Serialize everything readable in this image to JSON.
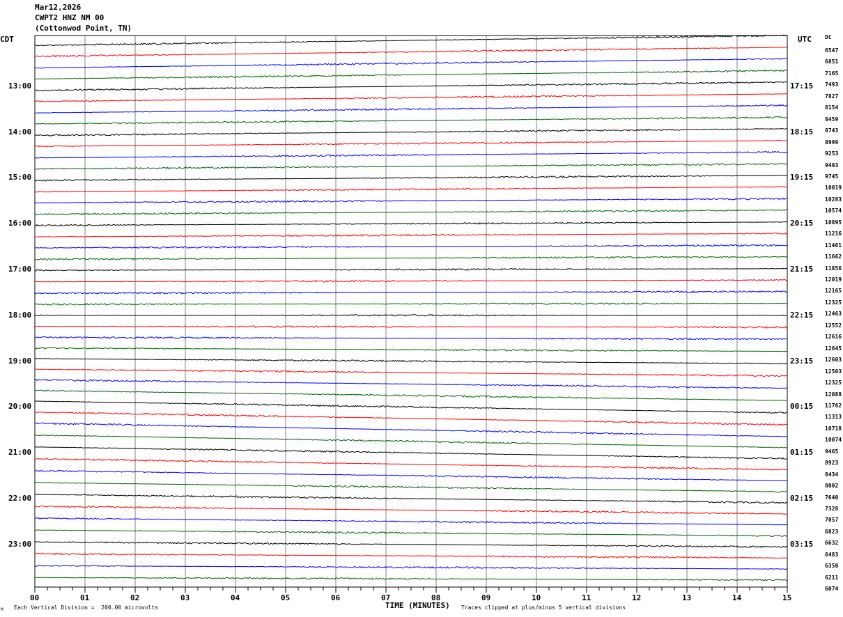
{
  "header": {
    "date": "Mar12,2026",
    "station": "CWPT2 HNZ NM 00",
    "location": "(Cottonwod Point, TN)"
  },
  "left_timezone": "CDT",
  "right_timezone": "UTC",
  "dc_label": "DC",
  "footer": {
    "scale_note": "Each Vertical Division =  200.00 microvolts",
    "clip_note": "Traces clipped at plus/minus 5 vertical divisions",
    "corner_mark": "M"
  },
  "colors": [
    "#000000",
    "#ff0000",
    "#0000ff",
    "#006400"
  ],
  "chart_data": {
    "type": "line",
    "xlabel": "TIME (MINUTES)",
    "x_ticks": [
      "00",
      "01",
      "02",
      "03",
      "04",
      "05",
      "06",
      "07",
      "08",
      "09",
      "10",
      "11",
      "12",
      "13",
      "14",
      "15"
    ],
    "xlim": [
      0,
      15
    ],
    "left_hour_labels": [
      {
        "trace": 4,
        "label": "13:00"
      },
      {
        "trace": 8,
        "label": "14:00"
      },
      {
        "trace": 12,
        "label": "15:00"
      },
      {
        "trace": 16,
        "label": "16:00"
      },
      {
        "trace": 20,
        "label": "17:00"
      },
      {
        "trace": 24,
        "label": "18:00"
      },
      {
        "trace": 28,
        "label": "19:00"
      },
      {
        "trace": 32,
        "label": "20:00"
      },
      {
        "trace": 36,
        "label": "21:00"
      },
      {
        "trace": 40,
        "label": "22:00"
      },
      {
        "trace": 44,
        "label": "23:00"
      }
    ],
    "right_hour_labels": [
      {
        "trace": 4,
        "label": "17:15"
      },
      {
        "trace": 8,
        "label": "18:15"
      },
      {
        "trace": 12,
        "label": "19:15"
      },
      {
        "trace": 16,
        "label": "20:15"
      },
      {
        "trace": 20,
        "label": "21:15"
      },
      {
        "trace": 24,
        "label": "22:15"
      },
      {
        "trace": 28,
        "label": "23:15"
      },
      {
        "trace": 32,
        "label": "00:15"
      },
      {
        "trace": 36,
        "label": "01:15"
      },
      {
        "trace": 40,
        "label": "02:15"
      },
      {
        "trace": 44,
        "label": "03:15"
      }
    ],
    "dc_offsets": [
      "6547",
      "6851",
      "7165",
      "7493",
      "7827",
      "8154",
      "8459",
      "8743",
      "8999",
      "9253",
      "9493",
      "9745",
      "10019",
      "10283",
      "10574",
      "10895",
      "11216",
      "11461",
      "11662",
      "11856",
      "12019",
      "12165",
      "12325",
      "12463",
      "12552",
      "12616",
      "12645",
      "12603",
      "12503",
      "12325",
      "12088",
      "11762",
      "11313",
      "10718",
      "10074",
      "9465",
      "8923",
      "8434",
      "8002",
      "7640",
      "7328",
      "7057",
      "6823",
      "6632",
      "6483",
      "6350",
      "6211",
      "6074"
    ],
    "trace_drift": [
      -1.2,
      -1.1,
      -1.1,
      -1.0,
      -1.0,
      -0.9,
      -0.9,
      -0.8,
      -0.8,
      -0.7,
      -0.7,
      -0.6,
      -0.6,
      -0.6,
      -0.5,
      -0.5,
      -0.4,
      -0.4,
      -0.3,
      -0.3,
      -0.2,
      -0.2,
      -0.2,
      -0.1,
      0.0,
      0.1,
      0.2,
      0.4,
      0.6,
      0.8,
      1.0,
      1.2,
      1.4,
      1.5,
      1.6,
      1.5,
      1.4,
      1.3,
      1.2,
      1.1,
      1.0,
      0.9,
      0.8,
      0.7,
      0.6,
      0.5,
      0.4,
      0.3
    ]
  }
}
